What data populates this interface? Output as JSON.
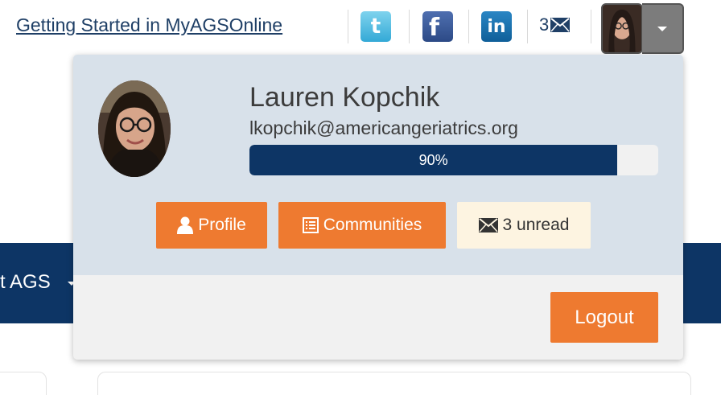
{
  "topbar": {
    "getting_started_link": "Getting Started in MyAGSOnline",
    "twitter_letter": "t",
    "facebook_letter": "f",
    "linkedin_letters": "in",
    "message_count": "3"
  },
  "nav": {
    "partial_label": "t AGS"
  },
  "dropdown": {
    "user_name": "Lauren Kopchik",
    "user_email": "lkopchik@americangeriatrics.org",
    "profile_completion": 0.9,
    "profile_completion_label": "90%",
    "profile_button": "Profile",
    "communities_button": "Communities",
    "unread_button": "3 unread",
    "logout_button": "Logout"
  },
  "colors": {
    "navy": "#0d3565",
    "orange": "#ee7a30",
    "panel": "#d8e1ea",
    "unread_bg": "#fdf4e1"
  },
  "icons": [
    "twitter-icon",
    "facebook-icon",
    "linkedin-icon",
    "envelope-icon",
    "caret-down-icon",
    "user-icon",
    "list-icon"
  ]
}
